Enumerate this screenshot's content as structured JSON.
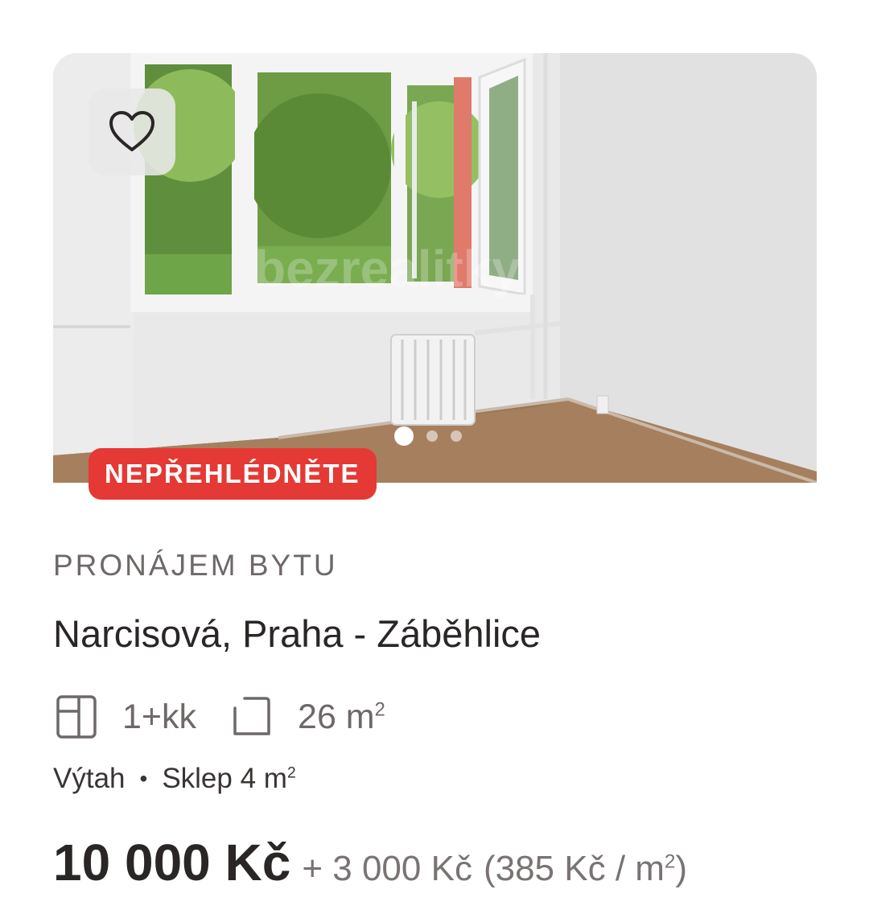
{
  "listing": {
    "photo_alt": "room photo",
    "watermark": "bezrealitky",
    "badge": "NEPŘEHLÉDNĚTE",
    "type": "PRONÁJEM BYTU",
    "address": "Narcisová, Praha - Záběhlice",
    "layout": "1+kk",
    "area_value": "26 m",
    "area_unit_sup": "2",
    "features": {
      "elevator": "Výtah",
      "separator": "•",
      "cellar": "Sklep 4 m",
      "cellar_sup": "2"
    },
    "price": "10 000 Kč",
    "extra_costs": "+ 3 000 Kč",
    "price_per_m2": "(385 Kč / m",
    "price_per_m2_sup": "2",
    "price_per_m2_close": ")"
  },
  "carousel": {
    "total": 3,
    "active": 1
  },
  "icons": {
    "favorite": "heart-outline-icon",
    "layout": "floorplan-icon",
    "area": "area-corner-icon"
  },
  "colors": {
    "badge_bg": "#e53935",
    "text_primary": "#2b2626",
    "text_secondary": "#6f6868"
  }
}
